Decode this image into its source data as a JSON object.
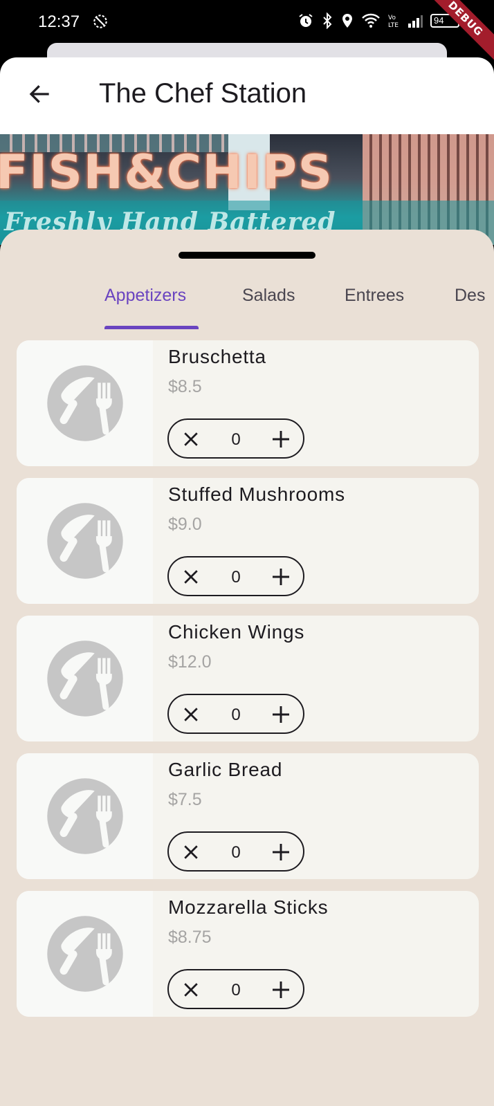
{
  "status_bar": {
    "time": "12:37",
    "battery": "94",
    "debug_banner": "DEBUG",
    "icons": [
      "alarm-icon",
      "bluetooth-icon",
      "location-icon",
      "wifi-icon",
      "volte-icon",
      "signal-icon",
      "battery-icon"
    ]
  },
  "app_bar": {
    "title": "The Chef Station",
    "back_icon": "arrow-back-icon"
  },
  "hero": {
    "sign_text": "FISH&CHIPS",
    "sign_subtext": "Freshly Hand Battered"
  },
  "tabs": [
    {
      "label": "Appetizers",
      "active": true
    },
    {
      "label": "Salads",
      "active": false
    },
    {
      "label": "Entrees",
      "active": false
    },
    {
      "label": "Des",
      "active": false
    }
  ],
  "menu_items": [
    {
      "name": "Bruschetta",
      "price": "$8.5",
      "quantity": "0"
    },
    {
      "name": "Stuffed Mushrooms",
      "price": "$9.0",
      "quantity": "0"
    },
    {
      "name": "Chicken Wings",
      "price": "$12.0",
      "quantity": "0"
    },
    {
      "name": "Garlic Bread",
      "price": "$7.5",
      "quantity": "0"
    },
    {
      "name": "Mozzarella Sticks",
      "price": "$8.75",
      "quantity": "0"
    }
  ],
  "colors": {
    "accent": "#6a44c0",
    "sheet_background": "#eae0d6",
    "card_background": "#f5f4ef",
    "price_text": "#a5a4a3",
    "placeholder_icon": "#c6c6c6"
  }
}
